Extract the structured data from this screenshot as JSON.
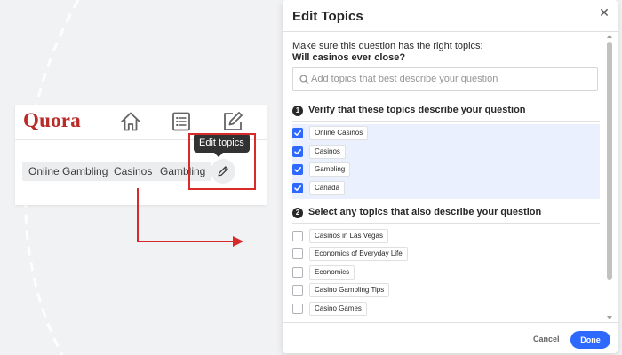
{
  "quora": {
    "logo": "Quora",
    "nav_icons": [
      "home-icon",
      "answer-icon",
      "write-icon"
    ],
    "topics": [
      "Online Gambling",
      "Casinos",
      "Gambling"
    ],
    "edit_icon": "pencil-icon",
    "tooltip": "Edit topics"
  },
  "annotation": {
    "highlight_color": "#d92a2a"
  },
  "modal": {
    "title": "Edit Topics",
    "close_icon": "close-icon",
    "intro": "Make sure this question has the right topics:",
    "question": "Will casinos ever close?",
    "search": {
      "placeholder": "Add topics that best describe your question",
      "value": ""
    },
    "section1": {
      "number": "1",
      "label": "Verify that these topics describe your question",
      "items": [
        {
          "label": "Online Casinos",
          "checked": true
        },
        {
          "label": "Casinos",
          "checked": true
        },
        {
          "label": "Gambling",
          "checked": true
        },
        {
          "label": "Canada",
          "checked": true
        }
      ]
    },
    "section2": {
      "number": "2",
      "label": "Select any topics that also describe your question",
      "items": [
        {
          "label": "Casinos in Las Vegas",
          "checked": false
        },
        {
          "label": "Economics of Everyday Life",
          "checked": false
        },
        {
          "label": "Economics",
          "checked": false
        },
        {
          "label": "Casino Gambling Tips",
          "checked": false
        },
        {
          "label": "Casino Games",
          "checked": false
        }
      ]
    },
    "footer": {
      "cancel_label": "Cancel",
      "done_label": "Done"
    },
    "accent_color": "#2e69ff"
  }
}
